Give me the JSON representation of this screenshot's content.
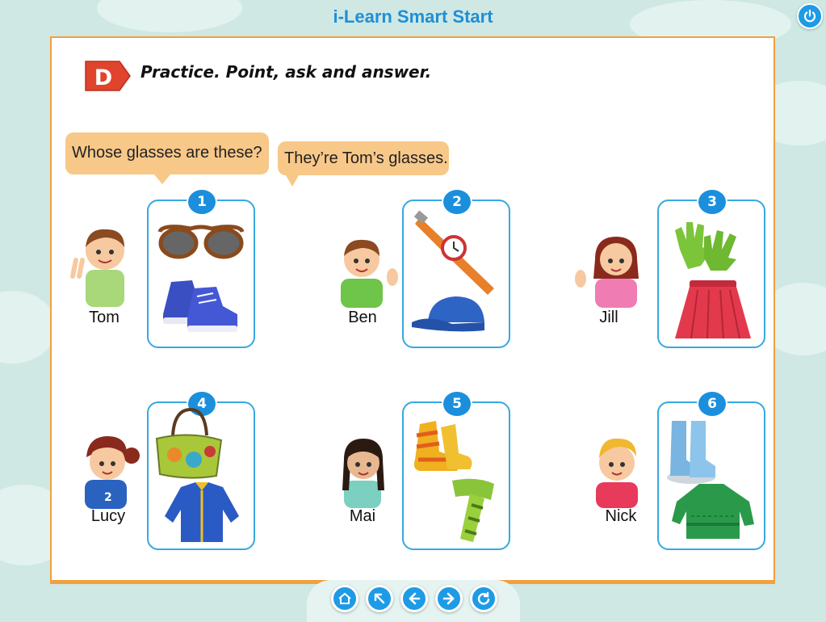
{
  "app": {
    "title": "i-Learn Smart Start"
  },
  "section": {
    "letter": "D",
    "instruction": "Practice. Point, ask and answer."
  },
  "bubbles": {
    "question": "Whose glasses are these?",
    "answer": "They’re Tom’s glasses."
  },
  "exercises": [
    {
      "number": "1",
      "name": "Tom",
      "items": [
        "glasses-icon",
        "sneakers-icon"
      ]
    },
    {
      "number": "2",
      "name": "Ben",
      "items": [
        "watch-icon",
        "cap-icon"
      ]
    },
    {
      "number": "3",
      "name": "Jill",
      "items": [
        "gloves-icon",
        "skirt-icon"
      ]
    },
    {
      "number": "4",
      "name": "Lucy",
      "items": [
        "bag-icon",
        "jacket-icon"
      ]
    },
    {
      "number": "5",
      "name": "Mai",
      "items": [
        "socks-icon",
        "scarf-icon"
      ]
    },
    {
      "number": "6",
      "name": "Nick",
      "items": [
        "boots-icon",
        "sweater-icon"
      ]
    }
  ],
  "nav": [
    "home-icon",
    "menu-icon",
    "back-icon",
    "next-icon",
    "replay-icon"
  ],
  "colors": {
    "accent": "#1e9be6",
    "card_border": "#36a9e1",
    "page_border": "#f0a040",
    "bubble": "#f8c888",
    "section_badge": "#e0442c",
    "background": "#cfe8e4"
  }
}
